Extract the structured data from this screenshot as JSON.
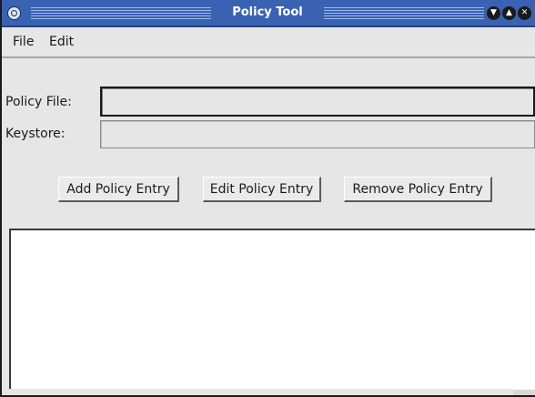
{
  "window": {
    "title": "Policy Tool",
    "controls": {
      "system_menu_icon": "window-menu-icon",
      "minimize_glyph": "▼",
      "maximize_glyph": "▲",
      "close_glyph": "✕"
    }
  },
  "menubar": {
    "items": [
      {
        "label": "File"
      },
      {
        "label": "Edit"
      }
    ]
  },
  "form": {
    "policy_file": {
      "label": "Policy File:",
      "value": ""
    },
    "keystore": {
      "label": "Keystore:",
      "value": ""
    }
  },
  "actions": {
    "add": "Add Policy Entry",
    "edit": "Edit Policy Entry",
    "remove": "Remove Policy Entry"
  },
  "policy_entries": [],
  "colors": {
    "titlebar": "#3a62b2",
    "window_bg": "#e6e6e6",
    "list_bg": "#ffffff"
  }
}
